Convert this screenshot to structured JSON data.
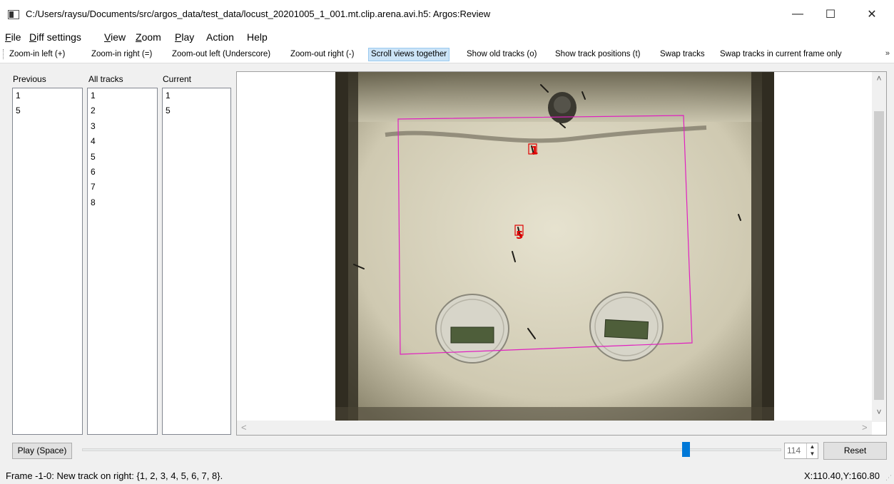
{
  "window": {
    "title": "C:/Users/raysu/Documents/src/argos_data/test_data/locust_20201005_1_001.mt.clip.arena.avi.h5: Argos:Review",
    "minimize_glyph": "—",
    "maximize_glyph": "☐",
    "close_glyph": "✕"
  },
  "menu": [
    {
      "first": "F",
      "rest": "ile"
    },
    {
      "first": "D",
      "rest": "iff settings"
    },
    {
      "first": "V",
      "rest": "iew"
    },
    {
      "first": "Z",
      "rest": "oom"
    },
    {
      "first": "P",
      "rest": "lay"
    },
    {
      "first": "",
      "rest": "Action"
    },
    {
      "first": "",
      "rest": "Help"
    }
  ],
  "toolbar": {
    "buttons": [
      "Zoom-in left (+)",
      "Zoom-in right (=)",
      "Zoom-out left (Underscore)",
      "Zoom-out right (-)",
      "Scroll views together",
      "Show old tracks (o)",
      "Show track positions (t)",
      "Swap tracks",
      "Swap tracks in current frame only"
    ],
    "active_index": 4,
    "more_glyph": "»"
  },
  "lists": {
    "previous": {
      "label": "Previous",
      "items": [
        "1",
        "5"
      ]
    },
    "all_tracks": {
      "label": "All tracks",
      "items": [
        "1",
        "2",
        "3",
        "4",
        "5",
        "6",
        "7",
        "8"
      ]
    },
    "current": {
      "label": "Current",
      "items": [
        "1",
        "5"
      ]
    }
  },
  "video": {
    "track_labels": [
      "1",
      "5"
    ],
    "track_color": "#e00000",
    "arena_outline_color": "#e020c0"
  },
  "scrollbars": {
    "up_glyph": "˄",
    "down_glyph": "˅",
    "left_glyph": "<",
    "right_glyph": ">"
  },
  "controls": {
    "play_label": "Play (Space)",
    "frame_value": "114",
    "reset_label": "Reset",
    "slider_fraction": 0.868
  },
  "status": {
    "message": "Frame -1-0: New track on right: {1, 2, 3, 4, 5, 6, 7, 8}.",
    "coords": "X:110.40,Y:160.80"
  }
}
